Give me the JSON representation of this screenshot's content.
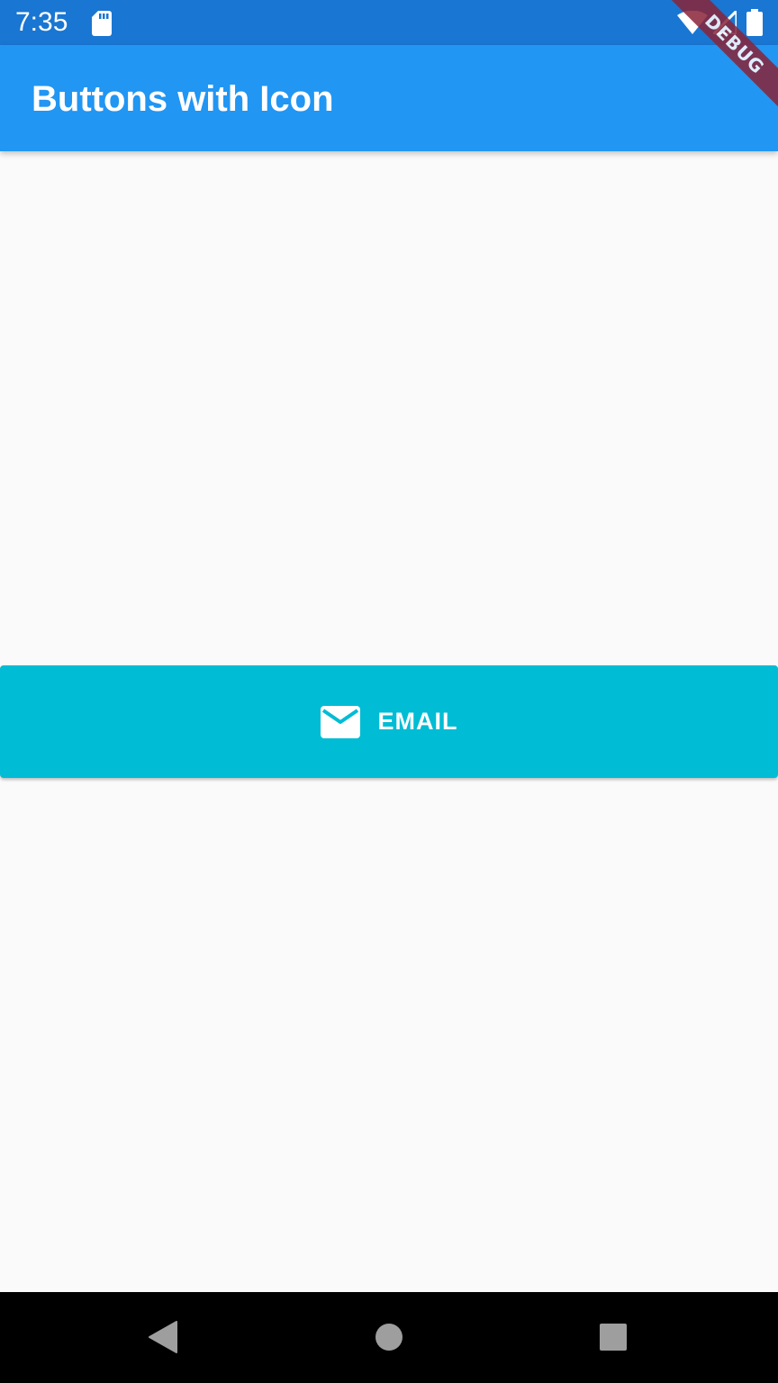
{
  "status_bar": {
    "time": "7:35",
    "icons": [
      "sd-card-icon",
      "wifi-icon",
      "signal-icon",
      "battery-icon"
    ]
  },
  "app_bar": {
    "title": "Buttons with Icon",
    "background_color": "#2196f3"
  },
  "debug_banner": {
    "label": "DEBUG",
    "color": "#8a2438"
  },
  "email_button": {
    "label": "EMAIL",
    "icon": "mail-icon",
    "background_color": "#00bcd4"
  },
  "nav_bar": {
    "icons": [
      "back-icon",
      "home-icon",
      "recents-icon"
    ]
  }
}
